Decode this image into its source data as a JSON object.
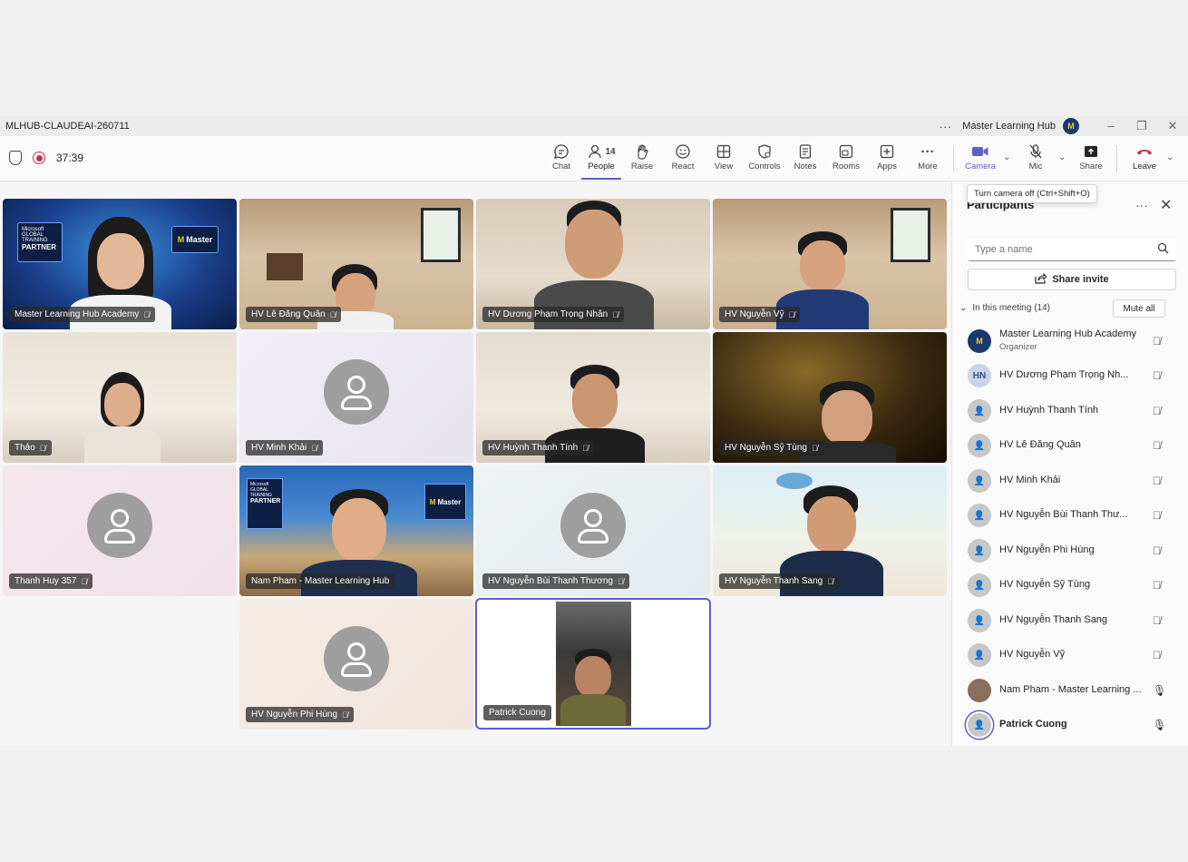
{
  "window": {
    "title": "MLHUB-CLAUDEAI-260711",
    "org_name": "Master Learning Hub",
    "org_avatar": "M"
  },
  "toolbar": {
    "timer": "37:39",
    "people_count": "14",
    "buttons": {
      "chat": "Chat",
      "people": "People",
      "raise": "Raise",
      "react": "React",
      "view": "View",
      "controls": "Controls",
      "notes": "Notes",
      "rooms": "Rooms",
      "apps": "Apps",
      "more": "More",
      "camera": "Camera",
      "mic": "Mic",
      "share": "Share",
      "leave": "Leave"
    },
    "tooltip": "Turn camera off (Ctrl+Shift+O)"
  },
  "tiles": [
    {
      "name": "Master Learning Hub Academy",
      "kind": "video"
    },
    {
      "name": "HV Lê Đăng Quân",
      "kind": "video"
    },
    {
      "name": "HV Dương Phạm Trọng Nhân",
      "kind": "video"
    },
    {
      "name": "HV Nguyễn Vỹ",
      "kind": "video"
    },
    {
      "name": "Thảo",
      "kind": "video"
    },
    {
      "name": "HV Minh Khải",
      "kind": "placeholder"
    },
    {
      "name": "HV Huỳnh Thanh Tính",
      "kind": "video"
    },
    {
      "name": "HV Nguyễn Sỹ Tùng",
      "kind": "video"
    },
    {
      "name": "Thanh Huy 357",
      "kind": "placeholder"
    },
    {
      "name": "Nam Pham - Master Learning Hub",
      "kind": "video"
    },
    {
      "name": "HV Nguyễn Bùi Thanh Thương",
      "kind": "placeholder"
    },
    {
      "name": "HV Nguyễn Thanh Sang",
      "kind": "video"
    },
    {
      "name": "HV Nguyễn Phi Hùng",
      "kind": "placeholder"
    },
    {
      "name": "Patrick Cuong",
      "kind": "video"
    }
  ],
  "panel": {
    "title": "Participants",
    "search_placeholder": "Type a name",
    "share_invite": "Share invite",
    "in_meeting": "In this meeting (14)",
    "mute_all": "Mute all",
    "participants": [
      {
        "name": "Master Learning Hub Academy",
        "role": "Organizer",
        "avatar": "M"
      },
      {
        "name": "HV Dương Phạm Trọng Nh...",
        "avatar": "HN"
      },
      {
        "name": "HV Huỳnh Thanh Tính"
      },
      {
        "name": "HV Lê Đăng Quân"
      },
      {
        "name": "HV Minh Khải"
      },
      {
        "name": "HV Nguyễn Bùi Thanh Thư..."
      },
      {
        "name": "HV Nguyễn Phi Hùng"
      },
      {
        "name": "HV Nguyễn Sỹ Tùng"
      },
      {
        "name": "HV Nguyễn Thanh Sang"
      },
      {
        "name": "HV Nguyễn Vỹ"
      },
      {
        "name": "Nam Pham - Master Learning ..."
      },
      {
        "name": "Patrick Cuong"
      }
    ]
  },
  "backdrops": {
    "mlh_partner_left": "Microsoft",
    "mlh_partner_sub": "GLOBAL TRAINING",
    "mlh_partner_big": "PARTNER",
    "mlh_brand": "Master"
  }
}
